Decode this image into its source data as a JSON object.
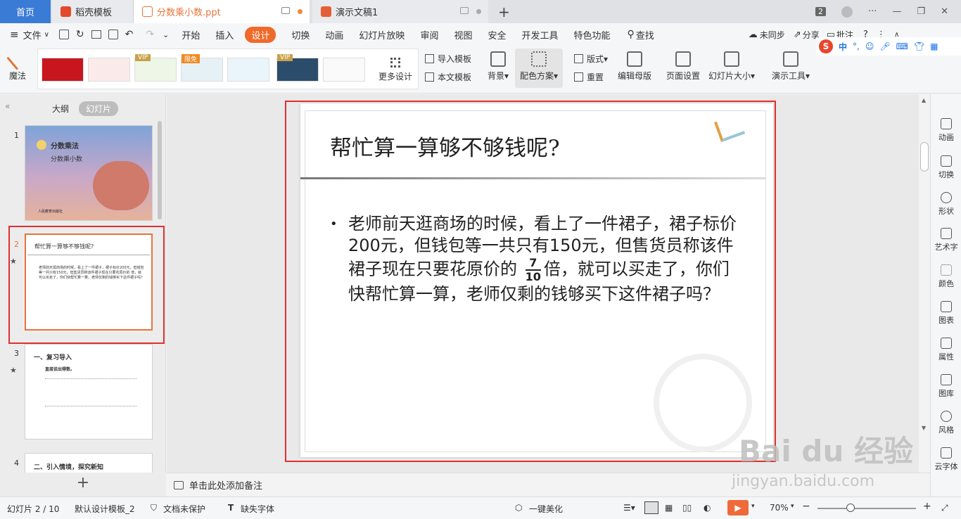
{
  "tabs": {
    "home": "首页",
    "template": "稻壳模板",
    "file": "分数乘小数.ppt",
    "doc": "演示文稿1",
    "count_badge": "2"
  },
  "menu": {
    "file": "文件",
    "items": [
      "开始",
      "插入",
      "设计",
      "切换",
      "动画",
      "幻灯片放映",
      "审阅",
      "视图",
      "安全",
      "开发工具",
      "特色功能"
    ],
    "search": "查找",
    "sync": "未同步",
    "share": "分享",
    "comment": "批注"
  },
  "ribbon": {
    "magic": "魔法",
    "more_design": "更多设计",
    "import_template": "导入模板",
    "this_template": "本文模板",
    "background": "背景",
    "color_scheme": "配色方案",
    "layout": "版式",
    "reset": "重置",
    "edit_master": "编辑母版",
    "page_setup": "页面设置",
    "slide_size": "幻灯片大小",
    "present_tools": "演示工具",
    "vip": "VIP",
    "limited": "限免",
    "ime_lang": "中"
  },
  "left_panel": {
    "outline_tab": "大纲",
    "slides_tab": "幻灯片",
    "slides": [
      {
        "num": "1",
        "title": "分数乘法",
        "subtitle": "分数乘小数",
        "footer": "人民教育出版社"
      },
      {
        "num": "2",
        "title": "帮忙算一算够不够钱呢?",
        "body": "老师前天逛商场的时候，看上了一件裙子，裙子标价200元，但钱包等一共只有150元，但售货员称该件裙子现在只要花原价的 倍，就可以买走了，你们快帮忙算一算，老师仅剩的钱够买下这件裙子吗？"
      },
      {
        "num": "3",
        "title": "一、复习导入",
        "subtitle": "直接说出得数。"
      },
      {
        "num": "4",
        "title": "二、引入情境，探究新知"
      }
    ]
  },
  "slide": {
    "title": "帮忙算一算够不够钱呢?",
    "bullet_part1": "老师前天逛商场的时候，看上了一件裙子，裙子标价",
    "price": "200",
    "bullet_part2": "元，但钱包等一共只有",
    "money": "150",
    "bullet_part3": "元，但售货员称该件裙子现在只要花原价的",
    "frac_num": "7",
    "frac_den": "10",
    "bullet_part4": "倍，就可以买走了，你们快帮忙算一算，老师仅剩的钱够买下这件裙子吗？"
  },
  "right_bar": [
    "动画",
    "切换",
    "形状",
    "艺术字",
    "颜色",
    "图表",
    "属性",
    "图库",
    "风格",
    "云字体"
  ],
  "notes": "单击此处添加备注",
  "status": {
    "slide_pos": "幻灯片 2 / 10",
    "template": "默认设计模板_2",
    "protect": "文档未保护",
    "missing_font": "缺失字体",
    "beautify": "一键美化",
    "zoom": "70%"
  },
  "watermark": {
    "brand": "Bai du 经验",
    "url": "jingyan.baidu.com"
  },
  "colors": {
    "accent": "#ef6a2a",
    "home_tab": "#3a7bd5",
    "selection": "#e03030"
  }
}
